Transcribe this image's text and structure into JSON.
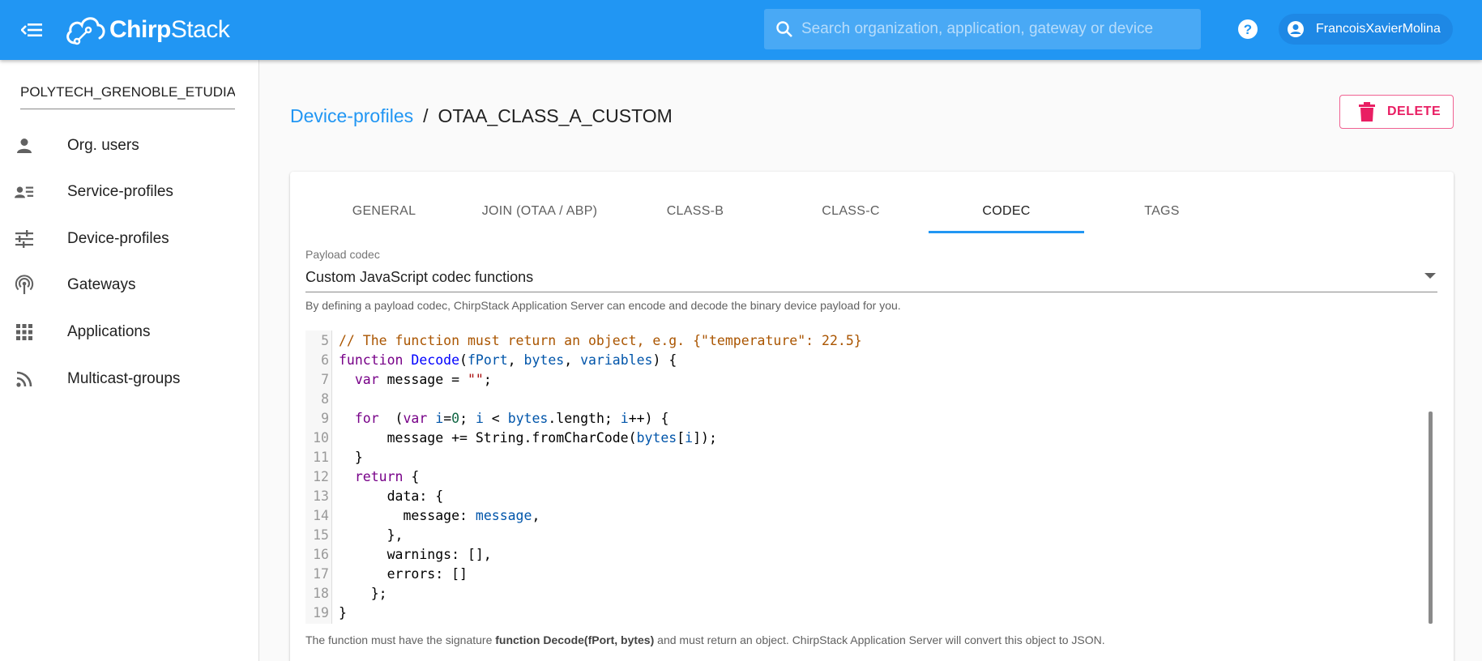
{
  "app": {
    "brand_bold": "Chirp",
    "brand_light": "Stack"
  },
  "header": {
    "search_placeholder": "Search organization, application, gateway or device",
    "user_name": "FrancoisXavierMolina"
  },
  "sidebar": {
    "organization": "POLYTECH_GRENOBLE_ETUDIANTS",
    "items": [
      {
        "label": "Org. users",
        "icon": "person-icon"
      },
      {
        "label": "Service-profiles",
        "icon": "account-details-icon"
      },
      {
        "label": "Device-profiles",
        "icon": "tune-icon"
      },
      {
        "label": "Gateways",
        "icon": "access-point-icon"
      },
      {
        "label": "Applications",
        "icon": "apps-grid-icon"
      },
      {
        "label": "Multicast-groups",
        "icon": "rss-icon"
      }
    ]
  },
  "breadcrumb": {
    "parent": "Device-profiles",
    "separator": "/",
    "current": "OTAA_CLASS_A_CUSTOM"
  },
  "delete_button": {
    "label": "DELETE",
    "icon": "trash-icon"
  },
  "tabs": [
    {
      "label": "GENERAL",
      "active": false
    },
    {
      "label": "JOIN (OTAA / ABP)",
      "active": false
    },
    {
      "label": "CLASS-B",
      "active": false
    },
    {
      "label": "CLASS-C",
      "active": false
    },
    {
      "label": "CODEC",
      "active": true
    },
    {
      "label": "TAGS",
      "active": false
    }
  ],
  "codec": {
    "field_label": "Payload codec",
    "selected": "Custom JavaScript codec functions",
    "helper_text": "By defining a payload codec, ChirpStack Application Server can encode and decode the binary device payload for you.",
    "footer_prefix": "The function must have the signature ",
    "footer_signature": "function Decode(fPort, bytes)",
    "footer_suffix": " and must return an object. ChirpStack Application Server will convert this object to JSON."
  },
  "editor": {
    "line_numbers": [
      "5",
      "6",
      "7",
      "8",
      "9",
      "10",
      "11",
      "12",
      "13",
      "14",
      "15",
      "16",
      "17",
      "18",
      "19"
    ],
    "lines": [
      "// The function must return an object, e.g. {\"temperature\": 22.5}",
      "function Decode(fPort, bytes, variables) {",
      "  var message = \"\";",
      "",
      "  for  (var i=0; i < bytes.length; i++) {",
      "      message += String.fromCharCode(bytes[i]);",
      "  }",
      "  return {",
      "      data: {",
      "        message: message,",
      "      },",
      "      warnings: [],",
      "      errors: []",
      "    };",
      "}"
    ]
  },
  "colors": {
    "primary": "#2196f3",
    "delete": "#e91e63"
  }
}
